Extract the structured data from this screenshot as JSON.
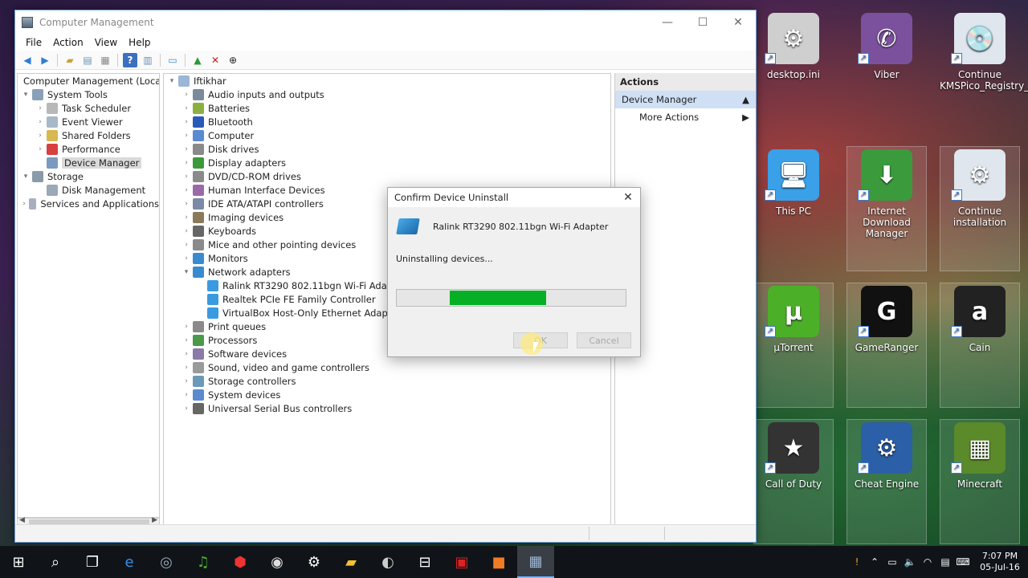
{
  "window": {
    "title": "Computer Management",
    "menu": [
      "File",
      "Action",
      "View",
      "Help"
    ]
  },
  "tree": {
    "root": "Computer Management (Local",
    "items": [
      {
        "label": "System Tools",
        "level": 1,
        "expander": "▾"
      },
      {
        "label": "Task Scheduler",
        "level": 2,
        "expander": "›"
      },
      {
        "label": "Event Viewer",
        "level": 2,
        "expander": "›"
      },
      {
        "label": "Shared Folders",
        "level": 2,
        "expander": "›"
      },
      {
        "label": "Performance",
        "level": 2,
        "expander": "›"
      },
      {
        "label": "Device Manager",
        "level": 2,
        "expander": "",
        "selected": true
      },
      {
        "label": "Storage",
        "level": 1,
        "expander": "▾"
      },
      {
        "label": "Disk Management",
        "level": 2,
        "expander": ""
      },
      {
        "label": "Services and Applications",
        "level": 1,
        "expander": "›"
      }
    ]
  },
  "devices": {
    "root": "Iftikhar",
    "categories": [
      {
        "label": "Audio inputs and outputs",
        "expanded": false
      },
      {
        "label": "Batteries",
        "expanded": false
      },
      {
        "label": "Bluetooth",
        "expanded": false
      },
      {
        "label": "Computer",
        "expanded": false
      },
      {
        "label": "Disk drives",
        "expanded": false
      },
      {
        "label": "Display adapters",
        "expanded": false
      },
      {
        "label": "DVD/CD-ROM drives",
        "expanded": false
      },
      {
        "label": "Human Interface Devices",
        "expanded": false
      },
      {
        "label": "IDE ATA/ATAPI controllers",
        "expanded": false
      },
      {
        "label": "Imaging devices",
        "expanded": false
      },
      {
        "label": "Keyboards",
        "expanded": false
      },
      {
        "label": "Mice and other pointing devices",
        "expanded": false
      },
      {
        "label": "Monitors",
        "expanded": false
      },
      {
        "label": "Network adapters",
        "expanded": true,
        "children": [
          "Ralink RT3290 802.11bgn Wi-Fi Adapter",
          "Realtek PCIe FE Family Controller",
          "VirtualBox Host-Only Ethernet Adapter"
        ]
      },
      {
        "label": "Print queues",
        "expanded": false
      },
      {
        "label": "Processors",
        "expanded": false
      },
      {
        "label": "Software devices",
        "expanded": false
      },
      {
        "label": "Sound, video and game controllers",
        "expanded": false
      },
      {
        "label": "Storage controllers",
        "expanded": false
      },
      {
        "label": "System devices",
        "expanded": false
      },
      {
        "label": "Universal Serial Bus controllers",
        "expanded": false
      }
    ]
  },
  "actions": {
    "header": "Actions",
    "section": "Device Manager",
    "more": "More Actions"
  },
  "dialog": {
    "title": "Confirm Device Uninstall",
    "device": "Ralink RT3290 802.11bgn Wi-Fi Adapter",
    "message": "Uninstalling devices...",
    "progress_start": 0.23,
    "progress_end": 0.65,
    "ok_label": "OK",
    "cancel_label": "Cancel"
  },
  "desktop_icons": [
    {
      "label": "desktop.ini",
      "name": "desktop-ini-icon",
      "glyph": "⚙",
      "color": "#cfcfcf"
    },
    {
      "label": "Viber",
      "name": "viber-icon",
      "glyph": "✆",
      "color": "#7b519d"
    },
    {
      "label": "Continue KMSPico_Registry_P...",
      "name": "kmspico-icon",
      "glyph": "💿",
      "color": "#dfe6ee"
    },
    {
      "label": "This PC",
      "name": "this-pc-icon",
      "glyph": "🖥",
      "color": "#3aa0e8"
    },
    {
      "label": "Internet Download Manager",
      "name": "idm-icon",
      "glyph": "⬇",
      "color": "#3b9a3b"
    },
    {
      "label": "Continue installation",
      "name": "installer-icon",
      "glyph": "⚙",
      "color": "#dfe6ee"
    },
    {
      "label": "µTorrent",
      "name": "utorrent-icon",
      "glyph": "µ",
      "color": "#4caf28"
    },
    {
      "label": "GameRanger",
      "name": "gameranger-icon",
      "glyph": "G",
      "color": "#111"
    },
    {
      "label": "Cain",
      "name": "cain-icon",
      "glyph": "a",
      "color": "#222"
    },
    {
      "label": "Call of Duty",
      "name": "call-of-duty-icon",
      "glyph": "★",
      "color": "#333"
    },
    {
      "label": "Cheat Engine",
      "name": "cheat-engine-icon",
      "glyph": "⚙",
      "color": "#2b5fa8"
    },
    {
      "label": "Minecraft",
      "name": "minecraft-icon",
      "glyph": "▦",
      "color": "#5a8a2a"
    }
  ],
  "clock": {
    "time": "7:07 PM",
    "date": "05-Jul-16"
  },
  "colors": {
    "progress": "#06b025",
    "selection": "#cfe0f5"
  }
}
